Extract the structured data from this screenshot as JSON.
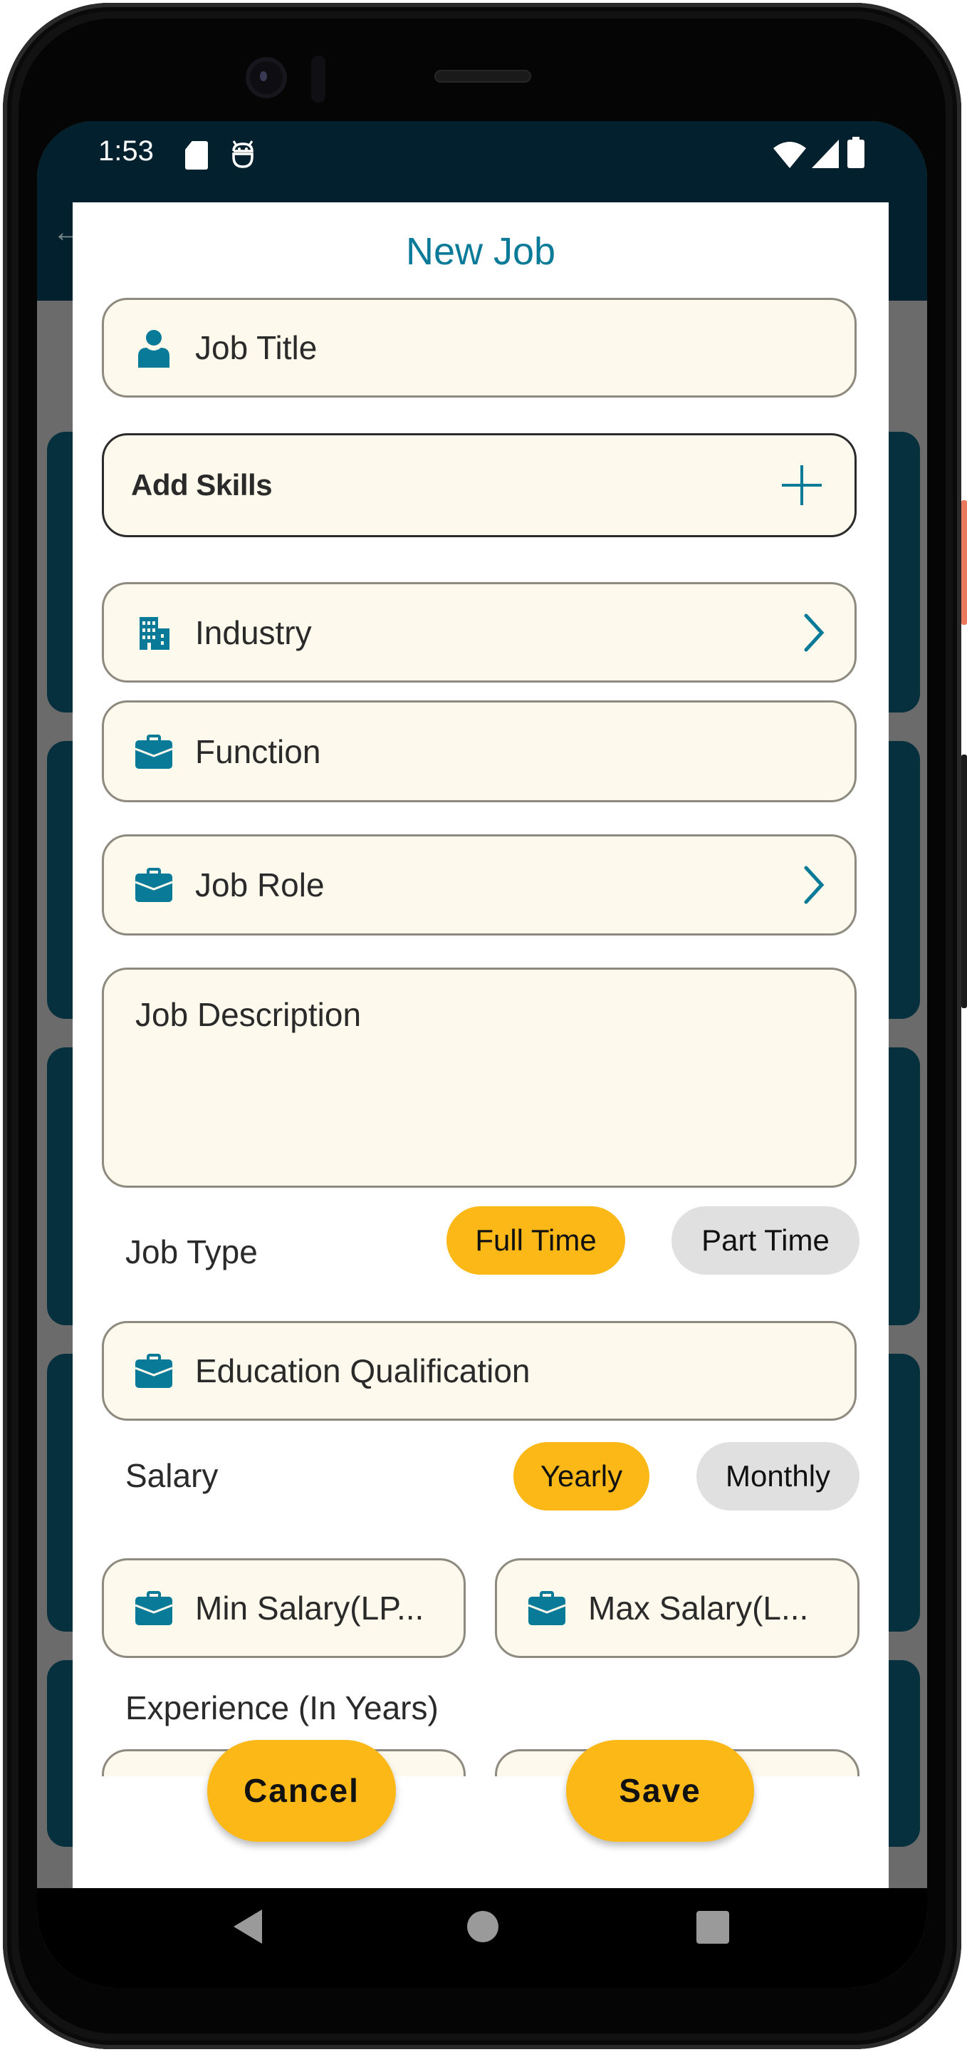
{
  "status_bar": {
    "time": "1:53",
    "left_icons": [
      "sd-card-icon",
      "robot-icon"
    ],
    "right_icons": [
      "wifi-icon",
      "signal-icon",
      "battery-icon"
    ]
  },
  "dialog": {
    "title": "New Job",
    "fields": {
      "job_title": {
        "label": "Job Title",
        "icon": "person-icon"
      },
      "add_skills": {
        "label": "Add Skills",
        "action_icon": "plus-icon"
      },
      "industry": {
        "label": "Industry",
        "icon": "building-icon",
        "action_icon": "chevron-right-icon"
      },
      "function": {
        "label": "Function",
        "icon": "briefcase-icon"
      },
      "job_role": {
        "label": "Job Role",
        "icon": "briefcase-icon",
        "action_icon": "chevron-right-icon"
      },
      "job_description": {
        "placeholder": "Job Description"
      },
      "education": {
        "label": "Education Qualification",
        "icon": "briefcase-icon"
      },
      "min_salary": {
        "label": "Min Salary(LP...",
        "icon": "briefcase-icon"
      },
      "max_salary": {
        "label": "Max Salary(L...",
        "icon": "briefcase-icon"
      }
    },
    "job_type": {
      "label": "Job Type",
      "options": [
        {
          "label": "Full Time",
          "selected": true
        },
        {
          "label": "Part Time",
          "selected": false
        }
      ]
    },
    "salary": {
      "label": "Salary",
      "options": [
        {
          "label": "Yearly",
          "selected": true
        },
        {
          "label": "Monthly",
          "selected": false
        }
      ]
    },
    "experience": {
      "label": "Experience (In Years)"
    },
    "buttons": {
      "cancel": "Cancel",
      "save": "Save"
    }
  },
  "colors": {
    "accent": "#0a7a99",
    "chip_selected": "#fbb817",
    "chip_unselected": "#e0e0e0",
    "field_bg": "#fdf9ec",
    "status_bar": "#02202d",
    "bg_card": "#07303f"
  }
}
